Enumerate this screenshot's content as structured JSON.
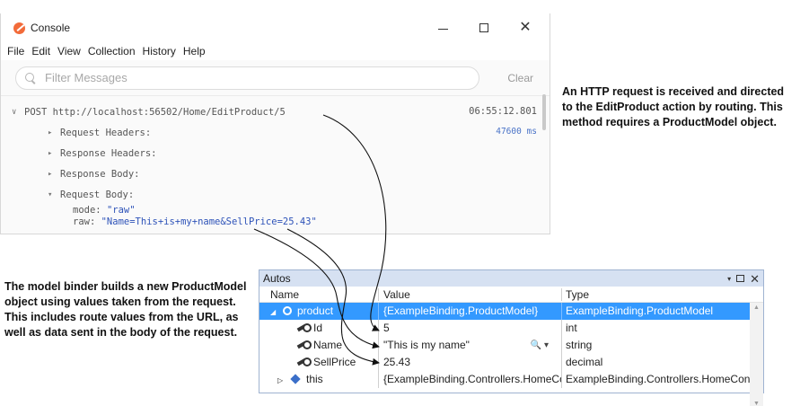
{
  "console": {
    "title": "Console",
    "window_controls": {
      "minimize": "—",
      "maximize": "☐",
      "close": "✕"
    },
    "menu": [
      "File",
      "Edit",
      "View",
      "Collection",
      "History",
      "Help"
    ],
    "filter": {
      "placeholder": "Filter Messages",
      "clear_label": "Clear"
    },
    "request": {
      "line": "POST http://localhost:56502/Home/EditProduct/5",
      "timestamp": "06:55:12.801",
      "duration": "47600 ms",
      "sections": [
        "Request Headers:",
        "Response Headers:",
        "Response Body:"
      ],
      "body_section": "Request Body:",
      "mode_key": "mode: ",
      "mode_value": "\"raw\"",
      "raw_key": "raw: ",
      "raw_value": "\"Name=This+is+my+name&SellPrice=25.43\""
    }
  },
  "annotations": {
    "right": "An HTTP request is received and directed to the EditProduct action by routing. This method requires a ProductModel object.",
    "left": "The model binder builds a new ProductModel object using values taken from the request. This includes route values from the URL, as well as data sent in the body of the request."
  },
  "autos": {
    "title": "Autos",
    "controls": {
      "pin": "▾",
      "restore": "☐",
      "close": "✕"
    },
    "columns": {
      "name": "Name",
      "value": "Value",
      "type": "Type"
    },
    "rows": [
      {
        "name": "product",
        "value": "{ExampleBinding.ProductModel}",
        "type": "ExampleBinding.ProductModel",
        "selected": true,
        "expander": "◢",
        "icon": "object-icon"
      },
      {
        "name": "Id",
        "value": "5",
        "type": "int",
        "icon": "property-wrench-icon"
      },
      {
        "name": "Name",
        "value": "\"This is my name\"",
        "type": "string",
        "icon": "property-wrench-icon",
        "visualizer": "🔍 ▾"
      },
      {
        "name": "SellPrice",
        "value": "25.43",
        "type": "decimal",
        "icon": "property-wrench-icon"
      },
      {
        "name": "this",
        "value": "{ExampleBinding.Controllers.HomeController}",
        "type": "ExampleBinding.Controllers.HomeController",
        "expander": "▷",
        "icon": "this-icon"
      }
    ]
  },
  "colors": {
    "selection": "#3399ff",
    "autos_title_bg": "#d6e1f2",
    "duration": "#4a73c7",
    "string_value": "#2d52b8",
    "app_icon": "#f26b3a"
  }
}
